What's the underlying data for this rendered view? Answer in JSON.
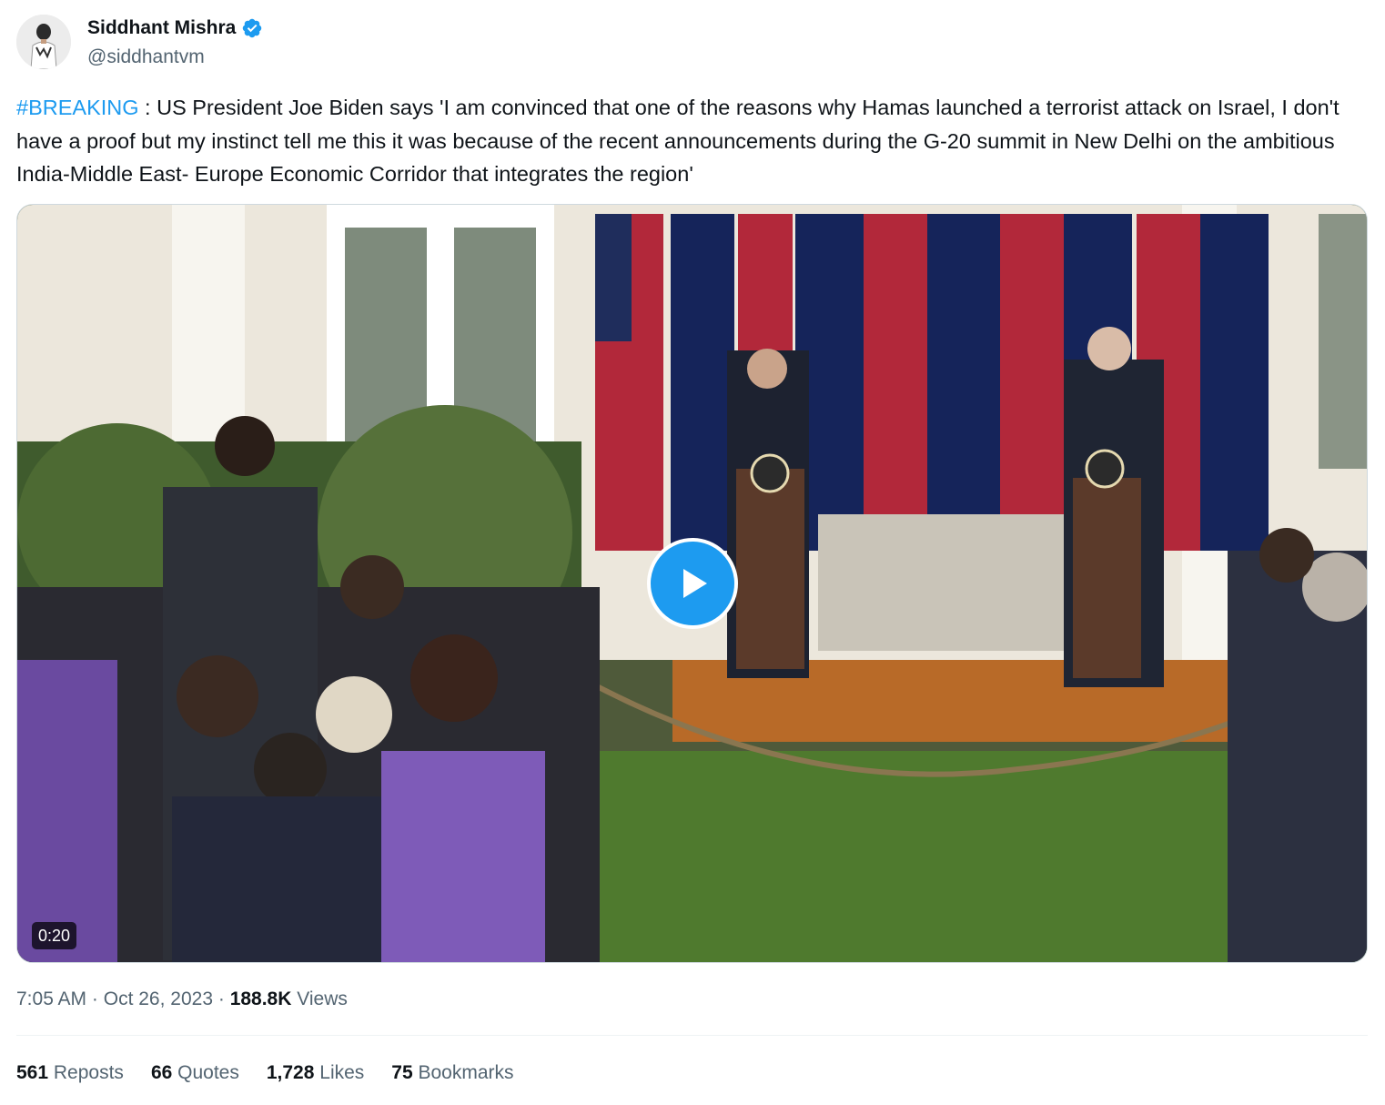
{
  "author": {
    "display_name": "Siddhant Mishra",
    "handle": "@siddhantvm",
    "verified": true
  },
  "tweet": {
    "hashtag": "#BREAKING",
    "text": " : US President Joe Biden says 'I am convinced that one of the reasons why Hamas launched a terrorist attack on Israel, I don't have a proof but my instinct tell me this it was because of the recent announcements during the G-20 summit in New Delhi on the ambitious India-Middle East- Europe Economic Corridor that integrates the region'"
  },
  "video": {
    "duration": "0:20",
    "play_icon": "play-icon"
  },
  "meta": {
    "time": "7:05 AM",
    "separator": "·",
    "date": "Oct 26, 2023",
    "views_count": "188.8K",
    "views_label": "Views"
  },
  "stats": {
    "reposts_count": "561",
    "reposts_label": "Reposts",
    "quotes_count": "66",
    "quotes_label": "Quotes",
    "likes_count": "1,728",
    "likes_label": "Likes",
    "bookmarks_count": "75",
    "bookmarks_label": "Bookmarks"
  },
  "colors": {
    "accent": "#1d9bf0",
    "text_primary": "#0f1419",
    "text_secondary": "#536471"
  }
}
